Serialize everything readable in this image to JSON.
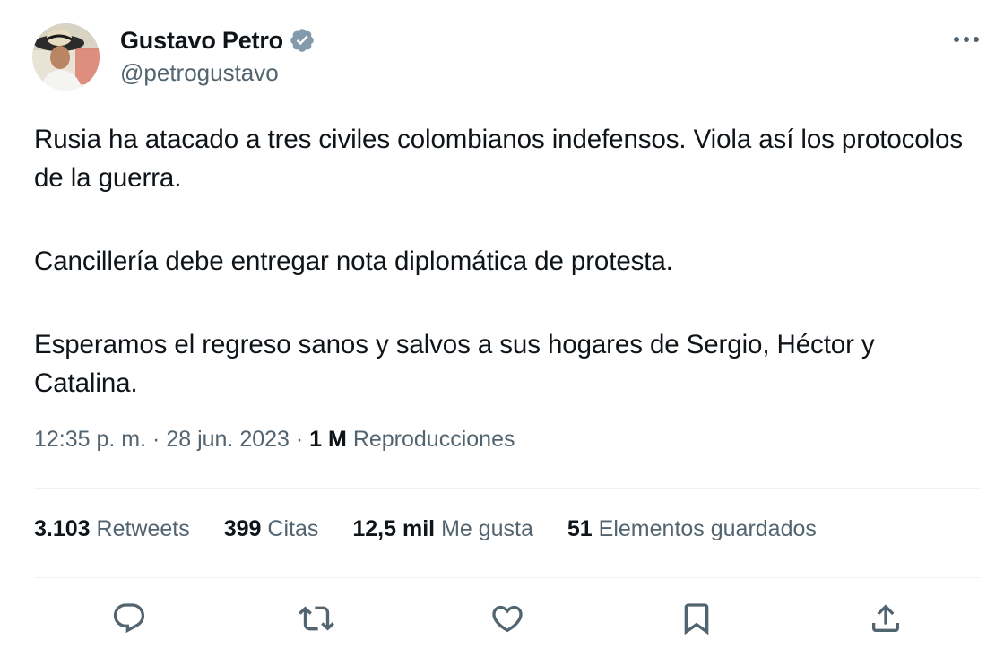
{
  "author": {
    "display_name": "Gustavo Petro",
    "handle": "@petrogustavo",
    "verified": true,
    "verified_icon": "verified-badge-icon",
    "avatar_icon": "avatar-photo"
  },
  "more_icon": "more-horizontal-icon",
  "tweet": {
    "paragraphs": [
      "Rusia ha atacado a tres civiles colombianos indefensos. Viola así los protocolos de la guerra.",
      "Cancillería debe entregar nota diplomática de protesta.",
      "Esperamos el regreso sanos y salvos a sus hogares de Sergio, Héctor y Catalina."
    ]
  },
  "meta": {
    "time": "12:35 p. m.",
    "separator": "·",
    "date": "28 jun. 2023",
    "views_count": "1 M",
    "views_label": "Reproducciones"
  },
  "stats": {
    "retweets": {
      "count": "3.103",
      "label": "Retweets"
    },
    "quotes": {
      "count": "399",
      "label": "Citas"
    },
    "likes": {
      "count": "12,5 mil",
      "label": "Me gusta"
    },
    "bookmarks": {
      "count": "51",
      "label": "Elementos guardados"
    }
  },
  "actions": [
    {
      "name": "reply-icon"
    },
    {
      "name": "retweet-icon"
    },
    {
      "name": "like-icon"
    },
    {
      "name": "bookmark-icon"
    },
    {
      "name": "share-icon"
    }
  ],
  "colors": {
    "text_primary": "#0f1419",
    "text_secondary": "#536471",
    "verified_badge": "#829aab",
    "divider": "#eff3f4"
  }
}
